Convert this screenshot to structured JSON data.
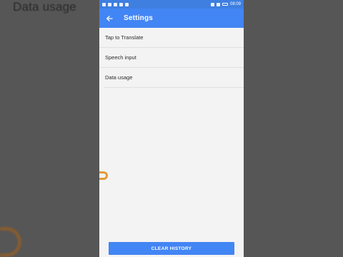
{
  "background": {
    "title": "Data usage"
  },
  "statusbar": {
    "time": "08:09",
    "battery_icon": "battery-icon"
  },
  "appbar": {
    "title": "Settings",
    "back_icon": "back-arrow-icon",
    "color": "#4285f4"
  },
  "settings_list": [
    {
      "label": "Tap to Translate"
    },
    {
      "label": "Speech input"
    },
    {
      "label": "Data usage"
    }
  ],
  "footer": {
    "clear_history_label": "CLEAR HISTORY"
  }
}
